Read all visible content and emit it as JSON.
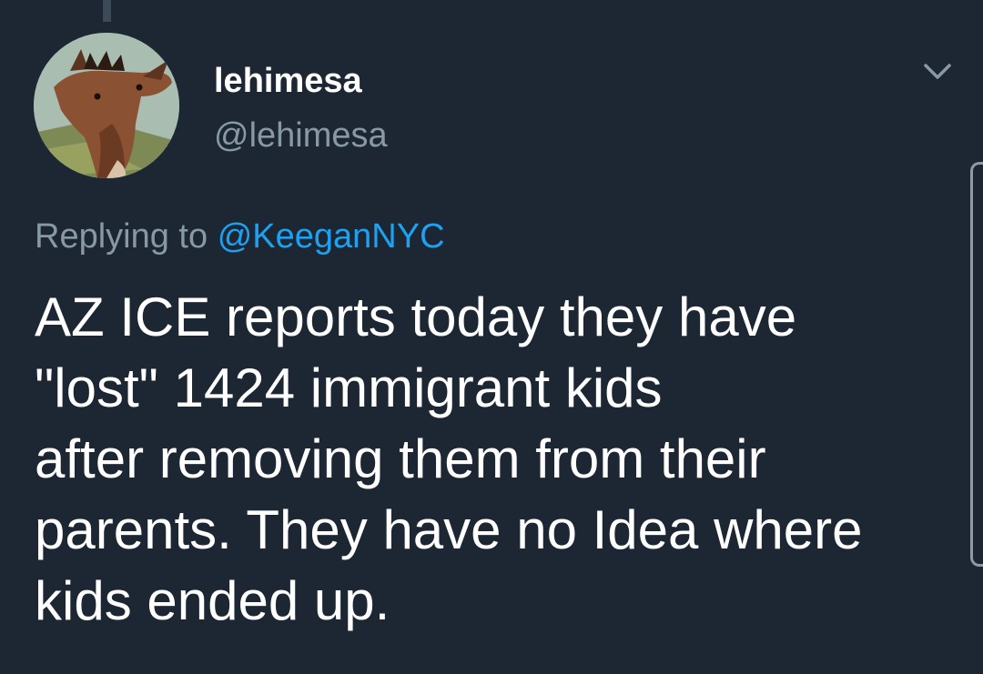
{
  "tweet": {
    "author": {
      "display_name": "lehimesa",
      "handle": "@lehimesa",
      "avatar_icon": "mule-avatar"
    },
    "reply": {
      "prefix": "Replying to",
      "target": "@KeeganNYC"
    },
    "text_lines": [
      "AZ ICE reports today they have",
      "\"lost\" 1424 immigrant kids",
      "after removing them from their",
      "parents. They have no Idea where",
      "kids ended up."
    ],
    "menu_icon": "chevron-down-icon"
  },
  "colors": {
    "background": "#1c2733",
    "text": "#ffffff",
    "secondary": "#8899a6",
    "link": "#1da1f2"
  }
}
